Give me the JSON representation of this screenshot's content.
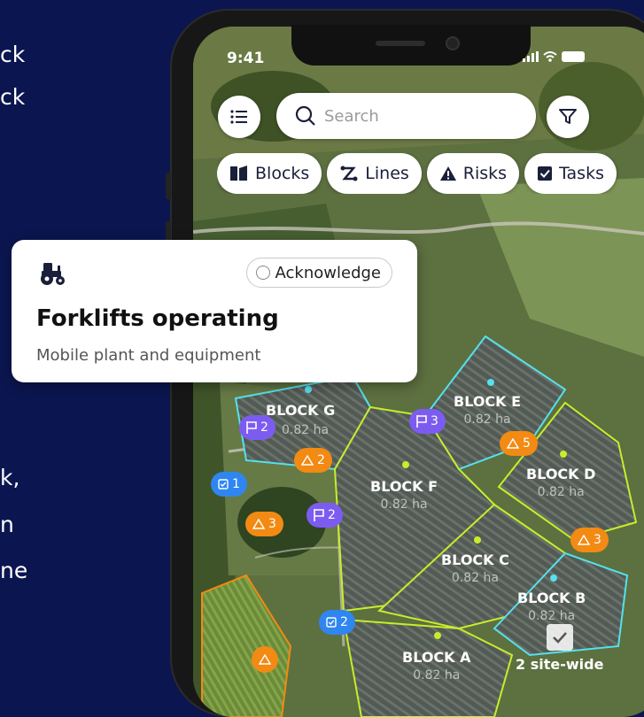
{
  "colors": {
    "background": "#0b1650",
    "purple": "#7c5cf0",
    "orange": "#f28a13",
    "blue": "#2f86f0",
    "cyan_outline": "#55e1ee",
    "lime_outline": "#c6ee2a"
  },
  "bg_text": {
    "line1": "ck",
    "line2": "ck",
    "line3": "k,",
    "line4": "n",
    "line5": "ne"
  },
  "status": {
    "time": "9:41"
  },
  "top": {
    "menu_icon": "list-icon",
    "search_placeholder": "Search",
    "filter_icon": "filter-icon"
  },
  "chips": [
    {
      "icon": "blocks-icon",
      "label": "Blocks"
    },
    {
      "icon": "lines-icon",
      "label": "Lines"
    },
    {
      "icon": "warning-icon",
      "label": "Risks"
    },
    {
      "icon": "task-check-icon",
      "label": "Tasks"
    }
  ],
  "card": {
    "icon": "tractor-icon",
    "acknowledge_label": "Acknowledge",
    "title": "Forklifts operating",
    "subtitle": "Mobile plant and equipment"
  },
  "blocks": [
    {
      "name": "BLOCK G",
      "area": "0.82 ha"
    },
    {
      "name": "BLOCK E",
      "area": "0.82 ha"
    },
    {
      "name": "BLOCK F",
      "area": "0.82 ha"
    },
    {
      "name": "BLOCK D",
      "area": "0.82 ha"
    },
    {
      "name": "BLOCK C",
      "area": "0.82 ha"
    },
    {
      "name": "BLOCK B",
      "area": "0.82 ha"
    },
    {
      "name": "BLOCK A",
      "area": "0.82 ha"
    }
  ],
  "badges": {
    "flag_g": "2",
    "flag_e": "3",
    "flag_mid": "2",
    "risk_g": "2",
    "risk_e": "5",
    "risk_left": "3",
    "risk_d": "3",
    "task_left": "1",
    "task_a": "2"
  },
  "sitewide_label": "2 site-wide"
}
